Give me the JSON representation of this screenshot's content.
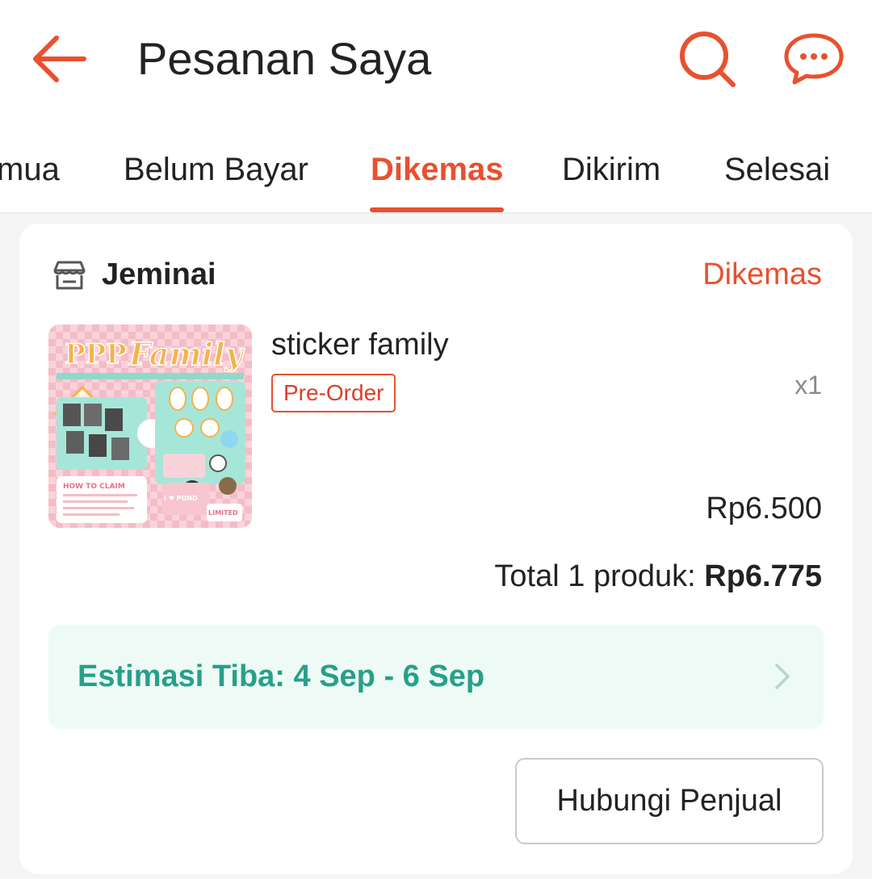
{
  "header": {
    "title": "Pesanan Saya",
    "back_icon": "arrow-left-icon",
    "search_icon": "search-icon",
    "chat_icon": "chat-icon",
    "accent_color": "#e8512e"
  },
  "tabs": [
    {
      "label": "mua",
      "active": false
    },
    {
      "label": "Belum Bayar",
      "active": false
    },
    {
      "label": "Dikemas",
      "active": true
    },
    {
      "label": "Dikirim",
      "active": false
    },
    {
      "label": "Selesai",
      "active": false
    }
  ],
  "order": {
    "shop_icon": "store-icon",
    "shop_name": "Jeminai",
    "status": "Dikemas",
    "product": {
      "name": "sticker family",
      "badge": "Pre-Order",
      "quantity": "x1",
      "price": "Rp6.500",
      "thumbnail": {
        "headline_a": "PPP",
        "headline_b": "Family",
        "section": "HOW TO CLAIM",
        "tag": "LIMITED",
        "sticker_text": "I ♥ POND"
      }
    },
    "total_label": "Total 1 produk:",
    "total_value": "Rp6.775",
    "estimate": "Estimasi Tiba: 4 Sep - 6 Sep",
    "estimate_color": "#27a08a",
    "contact_button": "Hubungi Penjual"
  }
}
